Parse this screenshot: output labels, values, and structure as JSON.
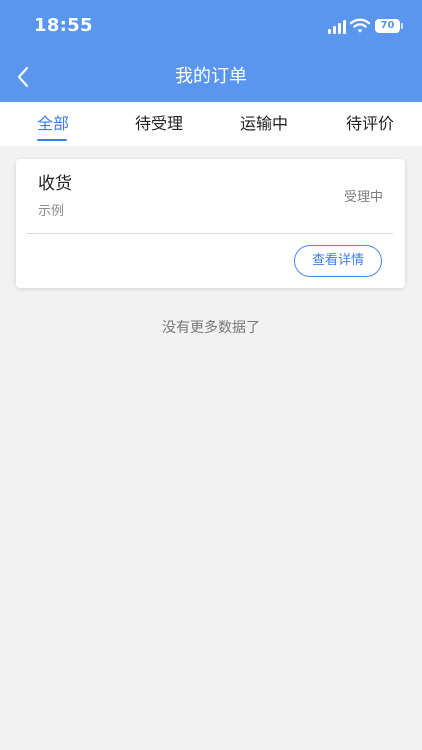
{
  "status_bar": {
    "time": "18:55",
    "battery": "70",
    "signal_icon": "cellular-signal-icon",
    "wifi_icon": "wifi-icon"
  },
  "nav": {
    "title": "我的订单",
    "back_icon": "chevron-left-icon"
  },
  "tabs": [
    {
      "label": "全部",
      "active": true
    },
    {
      "label": "待受理",
      "active": false
    },
    {
      "label": "运输中",
      "active": false
    },
    {
      "label": "待评价",
      "active": false
    }
  ],
  "orders": [
    {
      "title": "收货",
      "subtitle": "示例",
      "status": "受理中",
      "action": "查看详情"
    }
  ],
  "footer": {
    "empty_message": "没有更多数据了"
  },
  "colors": {
    "header": "#5b96ee",
    "accent": "#3f7de6",
    "background": "#f2f2f2"
  }
}
